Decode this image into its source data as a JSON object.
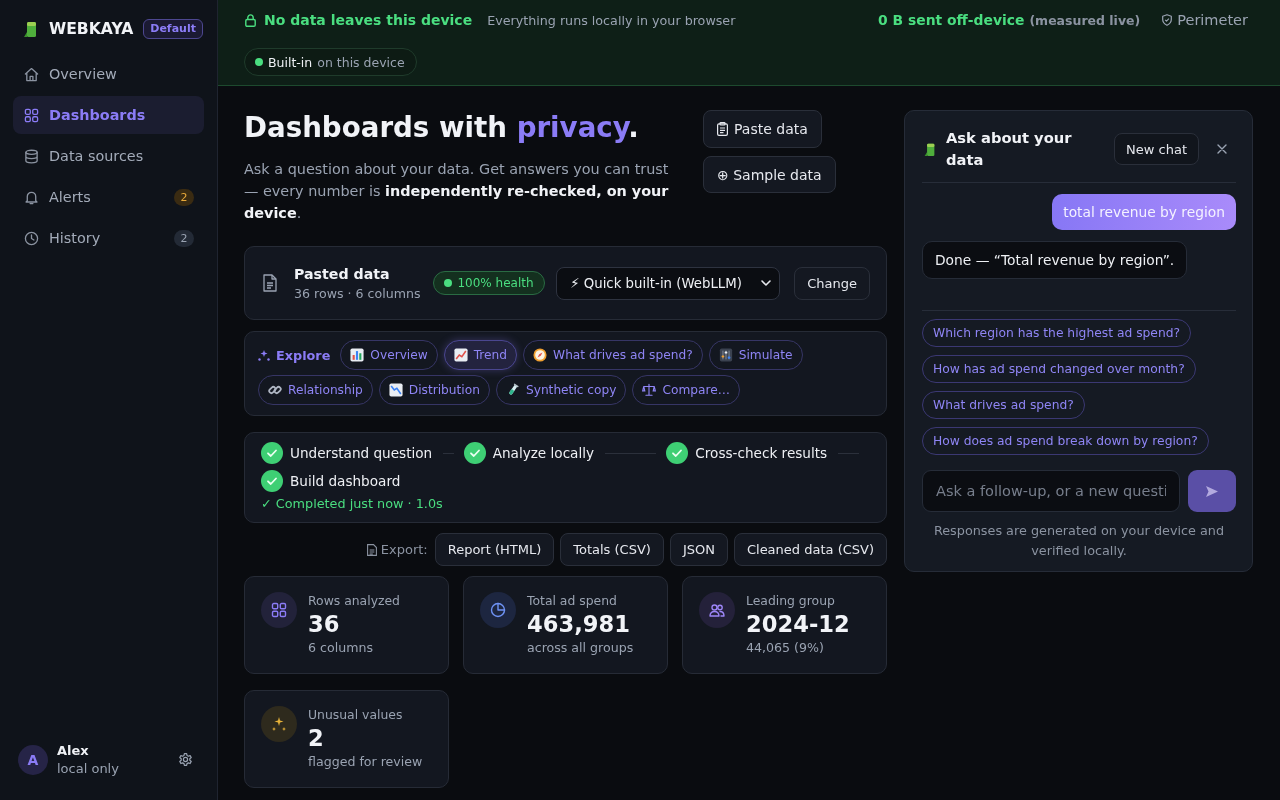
{
  "sidebar": {
    "brand": "WEBKAYA",
    "workspace_badge": "Default",
    "items": [
      {
        "label": "Overview",
        "selected": false
      },
      {
        "label": "Dashboards",
        "selected": true
      },
      {
        "label": "Data sources",
        "selected": false
      },
      {
        "label": "Alerts",
        "selected": false,
        "badge": {
          "text": "2",
          "kind": "warning"
        }
      },
      {
        "label": "History",
        "selected": false,
        "badge": {
          "text": "2",
          "kind": "neutral"
        }
      }
    ],
    "user": {
      "initial": "A",
      "name": "Alex",
      "status": "local only"
    }
  },
  "privacy_banner": {
    "headline": "No data leaves this device",
    "subtitle": "Everything runs locally in your browser",
    "traffic": "0 B sent off-device",
    "traffic_note": "(measured live)",
    "perimeter_link": "Perimeter",
    "model_pill": {
      "name": "Built-in",
      "location": "on this device"
    }
  },
  "hero": {
    "title_parts": [
      {
        "text": "Dashboards with ",
        "accent": false
      },
      {
        "text": "privacy",
        "accent": true
      },
      {
        "text": ".",
        "accent": false
      }
    ],
    "intro": "Ask a question about your data. Get answers you can trust — every number is **independently re-checked, on your device**.",
    "paste_button": "Paste data",
    "sample_button": "⊕ Sample data"
  },
  "dataset": {
    "name": "Pasted data",
    "summary": "36 rows · 6 columns",
    "health": "100% health",
    "model": "⚡ Quick built-in (WebLLM)",
    "change_button": "Change"
  },
  "explore": {
    "label": "Explore",
    "chips": [
      {
        "label": "Overview",
        "selected": false
      },
      {
        "label": "Trend",
        "selected": true
      },
      {
        "label": "What drives ad spend?",
        "selected": false
      },
      {
        "label": "Simulate",
        "selected": false
      },
      {
        "label": "Relationship",
        "selected": false
      },
      {
        "label": "Distribution",
        "selected": false
      },
      {
        "label": "Synthetic copy",
        "selected": false
      },
      {
        "label": "Compare…",
        "selected": false
      }
    ]
  },
  "progress": {
    "steps": [
      {
        "label": "Understand question",
        "done": true
      },
      {
        "label": "Analyze locally",
        "done": true
      },
      {
        "label": "Cross-check results",
        "done": true
      },
      {
        "label": "Build dashboard",
        "done": true
      }
    ],
    "status": "✓ Completed just now · 1.0s"
  },
  "export": {
    "label": "Export:",
    "formats": [
      "Report (HTML)",
      "Totals (CSV)",
      "JSON",
      "Cleaned data (CSV)"
    ]
  },
  "stats": [
    {
      "label": "Rows analyzed",
      "value": "36",
      "detail": "6 columns"
    },
    {
      "label": "Total ad spend",
      "value": "463,981",
      "detail": "across all groups"
    },
    {
      "label": "Leading group",
      "value": "2024-12",
      "detail": "44,065 (9%)"
    },
    {
      "label": "Unusual values",
      "value": "2",
      "detail": "flagged for review"
    }
  ],
  "chat": {
    "title": "Ask about your data",
    "new_chat_button": "New chat",
    "messages": [
      {
        "kind": "user",
        "text": "total revenue by region"
      },
      {
        "kind": "assistant",
        "text": "Done — “Total revenue by region”."
      }
    ],
    "suggestions": [
      "Which region has the highest ad spend?",
      "How has ad spend changed over month?",
      "What drives ad spend?",
      "How does ad spend break down by region?"
    ],
    "input": {
      "placeholder": "Ask a follow-up, or a new questi"
    },
    "footer": "Responses are generated on your device and verified locally."
  }
}
